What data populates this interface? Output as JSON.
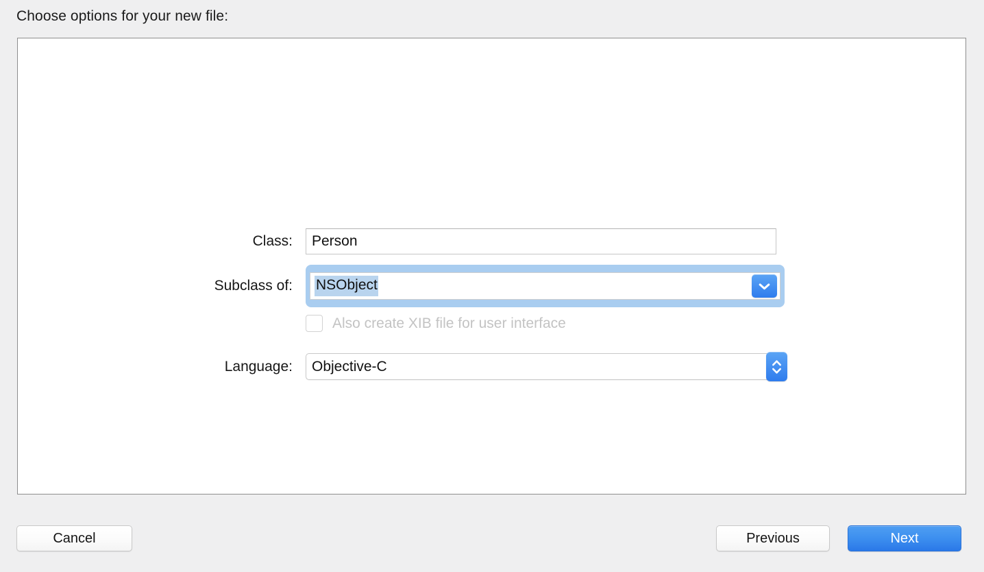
{
  "dialog": {
    "prompt": "Choose options for your new file:"
  },
  "form": {
    "class_row": {
      "label": "Class:",
      "value": "Person"
    },
    "subclass_row": {
      "label": "Subclass of:",
      "value": "NSObject",
      "dropdown_icon": "chevron-down-icon",
      "focused": "true"
    },
    "xib_row": {
      "label": "Also create XIB file for user interface",
      "checked": "false",
      "enabled": "false"
    },
    "language_row": {
      "label": "Language:",
      "value": "Objective-C",
      "stepper_icon": "chevron-up-down-icon"
    }
  },
  "footer": {
    "cancel_label": "Cancel",
    "previous_label": "Previous",
    "next_label": "Next"
  },
  "colors": {
    "accent_blue": "#2f7ced",
    "focus_ring": "#a9cdf0",
    "selection": "#b9d4ee",
    "disabled_text": "#c3c3c3",
    "window_bg": "#efeff0",
    "panel_bg": "#ffffff"
  }
}
